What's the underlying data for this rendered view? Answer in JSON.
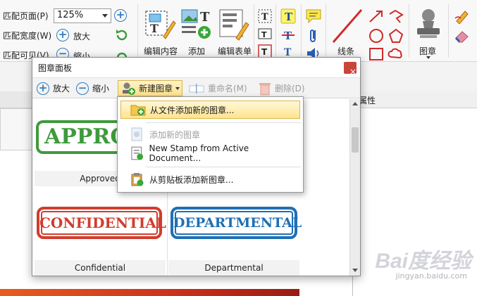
{
  "ribbon": {
    "fit_page": "匹配页面(P)",
    "fit_width": "匹配宽度(W)",
    "fit_visible": "匹配可见(V)",
    "zoom_value": "125%",
    "zoom_in": "放大",
    "zoom_out": "缩小",
    "edit_content": "编辑内容",
    "add": "添加",
    "edit_form": "编辑表单",
    "lines": "线条",
    "stamp": "图章"
  },
  "right_panel": {
    "title": "属性"
  },
  "dialog": {
    "title": "图章面板",
    "close_symbol": "×",
    "toolbar": {
      "zoom_in": "放大",
      "zoom_out": "缩小",
      "new_stamp": "新建图章",
      "rename": "重命名(M)",
      "delete": "删除(D)"
    },
    "stamps": [
      {
        "label": "Approved",
        "text": "APPROVED",
        "color": "#3f9a3c"
      },
      {
        "label": "Confidential",
        "text": "CONFIDENTIAL",
        "color": "#d23c2d"
      },
      {
        "label": "Departmental",
        "text": "DEPARTMENTAL",
        "color": "#1f6fb5"
      }
    ]
  },
  "menu": {
    "items": [
      {
        "label": "从文件添加新的图章...",
        "state": "highlighted"
      },
      {
        "label": "添加新的图章",
        "state": "disabled"
      },
      {
        "label": "New Stamp from Active Document...",
        "state": "normal"
      },
      {
        "label": "从剪贴板添加新图章...",
        "state": "normal"
      }
    ]
  },
  "watermark": {
    "main": "Bai度经验",
    "sub": "jingyan.baidu.com"
  }
}
